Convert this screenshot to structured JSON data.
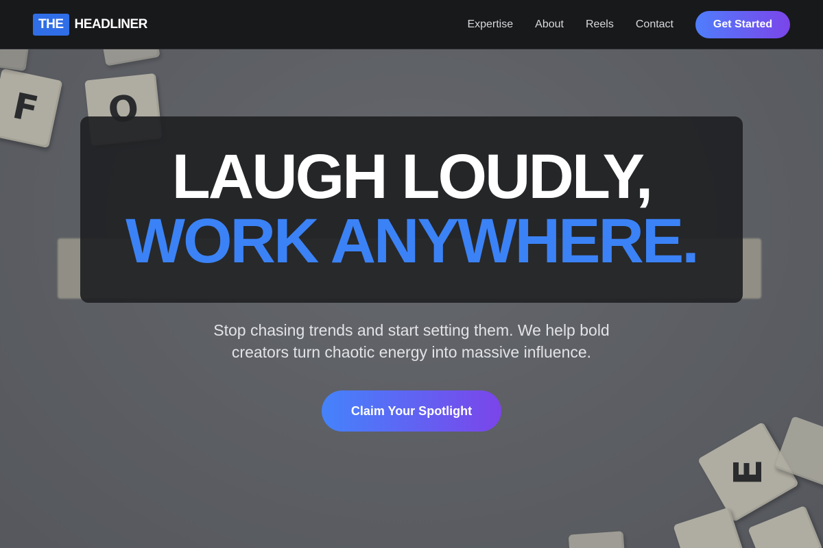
{
  "nav": {
    "logo_box": "THE",
    "logo_text": "HEADLINER",
    "links": [
      "Expertise",
      "About",
      "Reels",
      "Contact"
    ],
    "cta_label": "Get Started"
  },
  "hero": {
    "headline_line1": "LAUGH LOUDLY,",
    "headline_line2": "WORK ANYWHERE.",
    "subtitle": "Stop chasing trends and start setting them. We help bold creators turn chaotic energy into massive influence.",
    "cta_label": "Claim Your Spotlight",
    "background_tiles": [
      "F",
      "O",
      "E"
    ]
  },
  "colors": {
    "accent_blue": "#3b82f6",
    "logo_blue": "#2f6ee6",
    "gradient_start": "#4f7dfb",
    "gradient_end": "#7b45ea",
    "navbar_bg": "#18191b"
  }
}
